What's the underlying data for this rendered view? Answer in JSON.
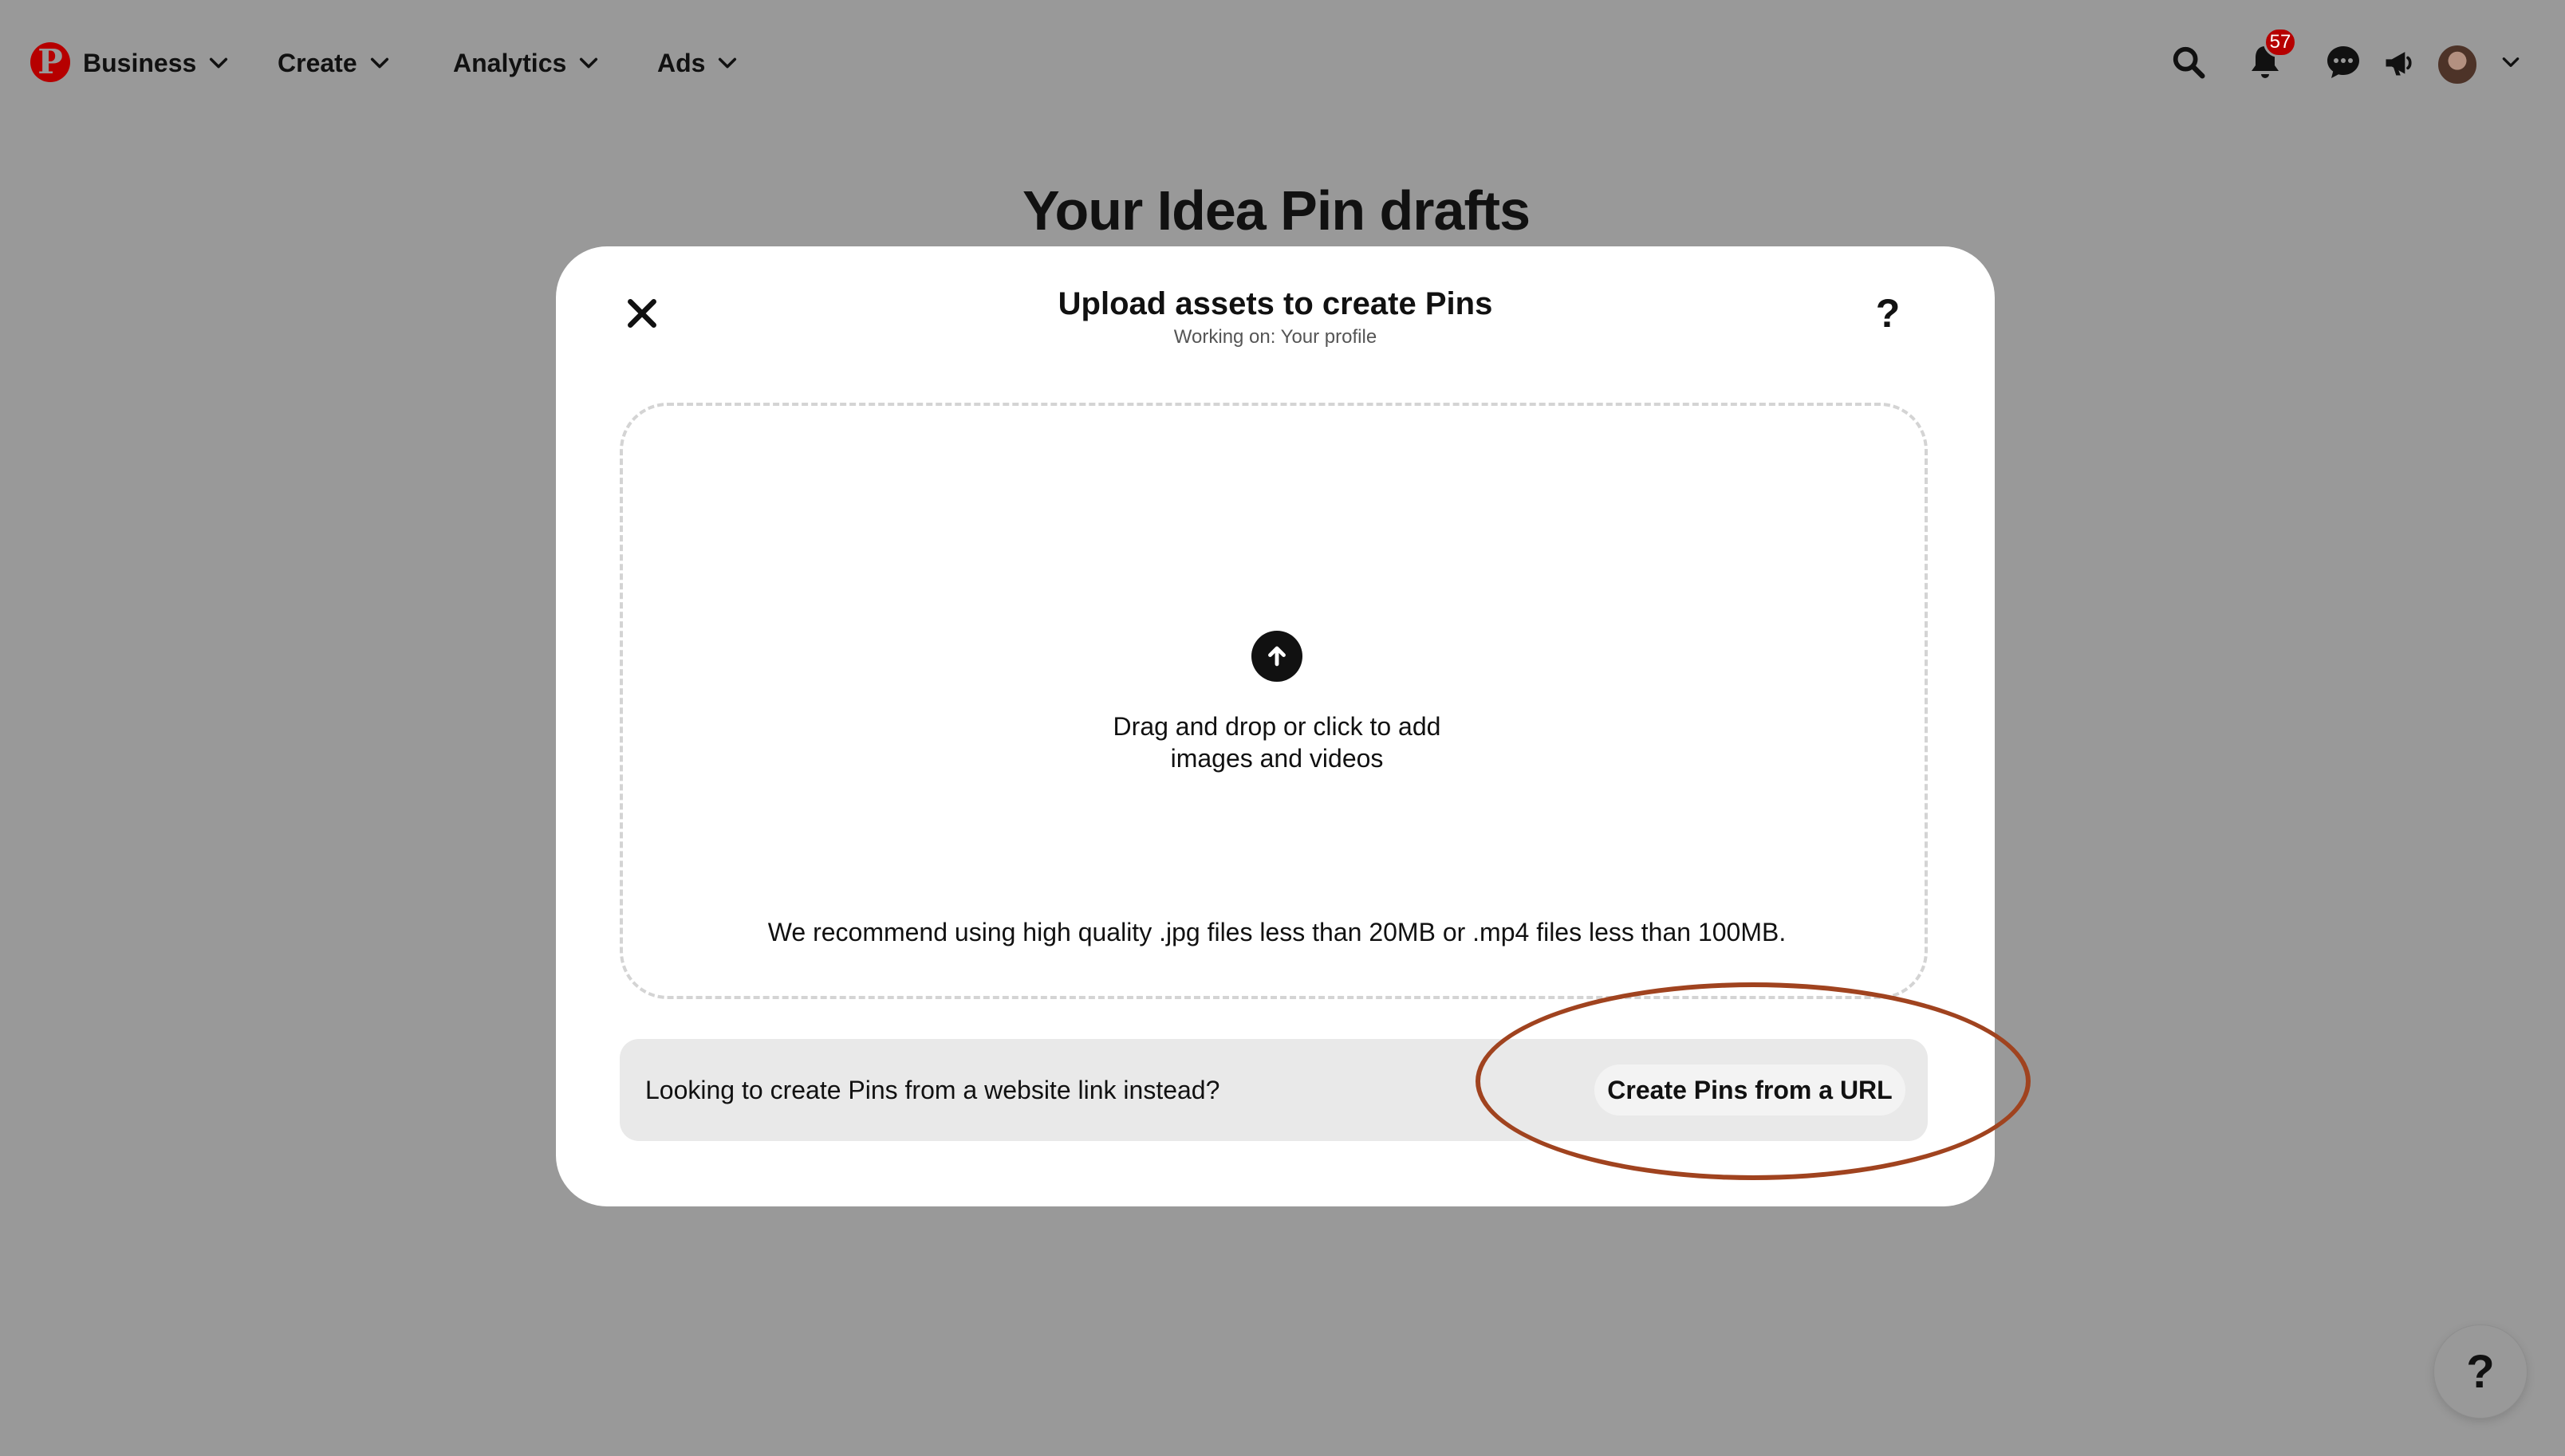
{
  "nav": {
    "logo_letter": "P",
    "items": [
      {
        "label": "Business"
      },
      {
        "label": "Create"
      },
      {
        "label": "Analytics"
      },
      {
        "label": "Ads"
      }
    ],
    "notification_count": "57"
  },
  "page": {
    "title": "Your Idea Pin drafts"
  },
  "modal": {
    "title": "Upload assets to create Pins",
    "subtitle": "Working on: Your profile",
    "help_label": "?",
    "dropzone": {
      "line1": "Drag and drop or click to add",
      "line2": "images and videos",
      "recommendation": "We recommend using high quality .jpg files less than 20MB or .mp4 files less than 100MB."
    },
    "url_bar": {
      "prompt": "Looking to create Pins from a website link instead?",
      "button_label": "Create Pins from a URL"
    }
  },
  "floating_help": {
    "label": "?"
  },
  "colors": {
    "brand_red": "#b60000",
    "overlay_background": "#999999",
    "modal_background": "#ffffff",
    "highlight_annotation": "#a0431f"
  },
  "icons": {
    "search": "search-icon",
    "bell": "bell-icon",
    "messages": "chat-bubble-icon",
    "updates": "megaphone-icon",
    "close": "close-icon",
    "upload": "upload-arrow-icon",
    "chevron": "chevron-down-icon"
  }
}
